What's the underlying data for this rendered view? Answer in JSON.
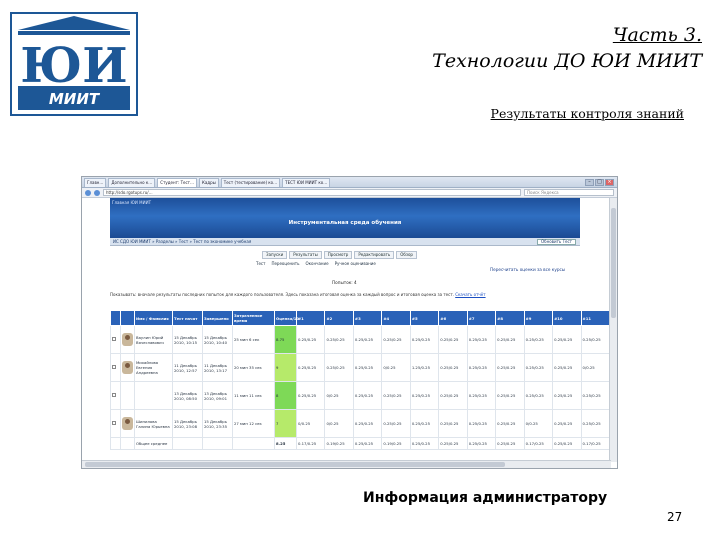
{
  "slide": {
    "title_line1": "Часть 3.",
    "title_line2": "Технологии ДО ЮИ МИИТ",
    "subtitle": "Результаты контроля знаний",
    "caption": "Информация администратору",
    "page_number": "27",
    "logo": {
      "monogram": "ЮИ",
      "wordmark": "МИИТ",
      "color": "#1d5796"
    }
  },
  "browser": {
    "tabs": [
      "Главн…",
      "Дополнительно к…",
      "Студент: Тест…",
      "Кадры",
      "Тест (тестирование) ко…",
      "ТЕСТ ЮИ МИИТ ко…"
    ],
    "url": "http://sdo.rgotups.ru/…",
    "search_placeholder": "Поиск Яндекса"
  },
  "lms": {
    "banner_left": "Главная ЮИ МИИТ",
    "banner_title": "Инструментальная среда обучения",
    "menu": "ИС СДО ЮИ МИИТ » Разделы » Тест » Тест по экономике учебная",
    "menu_button": "Обновить Тест",
    "tools": [
      "Запуски",
      "Результаты",
      "Просмотр",
      "Редактировать",
      "Обзор"
    ],
    "tools2": [
      "Тест",
      "Переоценить",
      "Окончание",
      "Ручное оценивание"
    ],
    "promo_link": "Пересчитать оценки за все курсы",
    "session": "Попыток: 4",
    "notice": "Показывать: вначале результаты последних попыток для каждого пользователя. Здесь показана итоговая оценка за каждый вопрос и итоговая оценка за тест.",
    "notice_link": "Скачать отчёт",
    "table": {
      "headers": [
        "",
        "",
        "Имя / Фамилия",
        "Тест начат",
        "Завершено",
        "Затраченное время",
        "Оценка/10",
        "#1",
        "#2",
        "#3",
        "#4",
        "#5",
        "#6",
        "#7",
        "#8",
        "#9",
        "#10",
        "#11"
      ],
      "rows": [
        {
          "photo": true,
          "name": "Ваулин Юрий Вячеславович",
          "started": "15 Декабрь 2010, 10:15",
          "finished": "15 Декабрь 2010, 10:40",
          "duration": "25 мин 6 сек",
          "score": "8.75",
          "marks": [
            "0.25/0.25",
            "0.25/0.25",
            "0.25/0.25",
            "0.25/0.25",
            "0.25/0.25",
            "0.25/0.25",
            "0.25/0.25",
            "0.25/0.25",
            "0.25/0.25",
            "0.25/0.25",
            "0.25/0.25"
          ]
        },
        {
          "photo": true,
          "name": "Михайлова Евгения Андреевна",
          "started": "11 Декабрь 2010, 12:57",
          "finished": "11 Декабрь 2010, 13:17",
          "duration": "20 мин 35 сек",
          "score": "9",
          "marks": [
            "0.25/0.25",
            "0.25/0.25",
            "0.25/0.25",
            "0/0.25",
            "1.25/0.25",
            "0.25/0.25",
            "0.25/0.25",
            "0.25/0.25",
            "0.25/0.25",
            "0.25/0.25",
            "0/0.25"
          ]
        },
        {
          "photo": false,
          "name": "",
          "started": "13 Декабрь 2010, 08:50",
          "finished": "13 Декабрь 2010, 09:01",
          "duration": "11 мин 11 сек",
          "score": "8",
          "marks": [
            "0.25/0.25",
            "0/0.25",
            "0.25/0.25",
            "0.25/0.25",
            "0.25/0.25",
            "0.25/0.25",
            "0.25/0.25",
            "0.25/0.25",
            "0.25/0.25",
            "0.25/0.25",
            "0.25/0.25"
          ]
        },
        {
          "photo": true,
          "name": "Шипилова Галина Юрьевна",
          "started": "15 Декабрь 2010, 23:08",
          "finished": "15 Декабрь 2010, 23:35",
          "duration": "27 мин 12 сек",
          "score": "7",
          "marks": [
            "0/0.25",
            "0/0.25",
            "0.25/0.25",
            "0.25/0.25",
            "0.25/0.25",
            "0.25/0.25",
            "0.25/0.25",
            "0.25/0.25",
            "0/0.25",
            "0.25/0.25",
            "0.25/0.25"
          ]
        }
      ],
      "footer": {
        "label": "Общее среднее",
        "score": "8.25",
        "marks": [
          "0.17/0.25",
          "0.19/0.25",
          "0.25/0.25",
          "0.19/0.25",
          "0.25/0.25",
          "0.25/0.25",
          "0.25/0.25",
          "0.25/0.25",
          "0.17/0.25",
          "0.25/0.25",
          "0.17/0.25"
        ]
      }
    }
  }
}
